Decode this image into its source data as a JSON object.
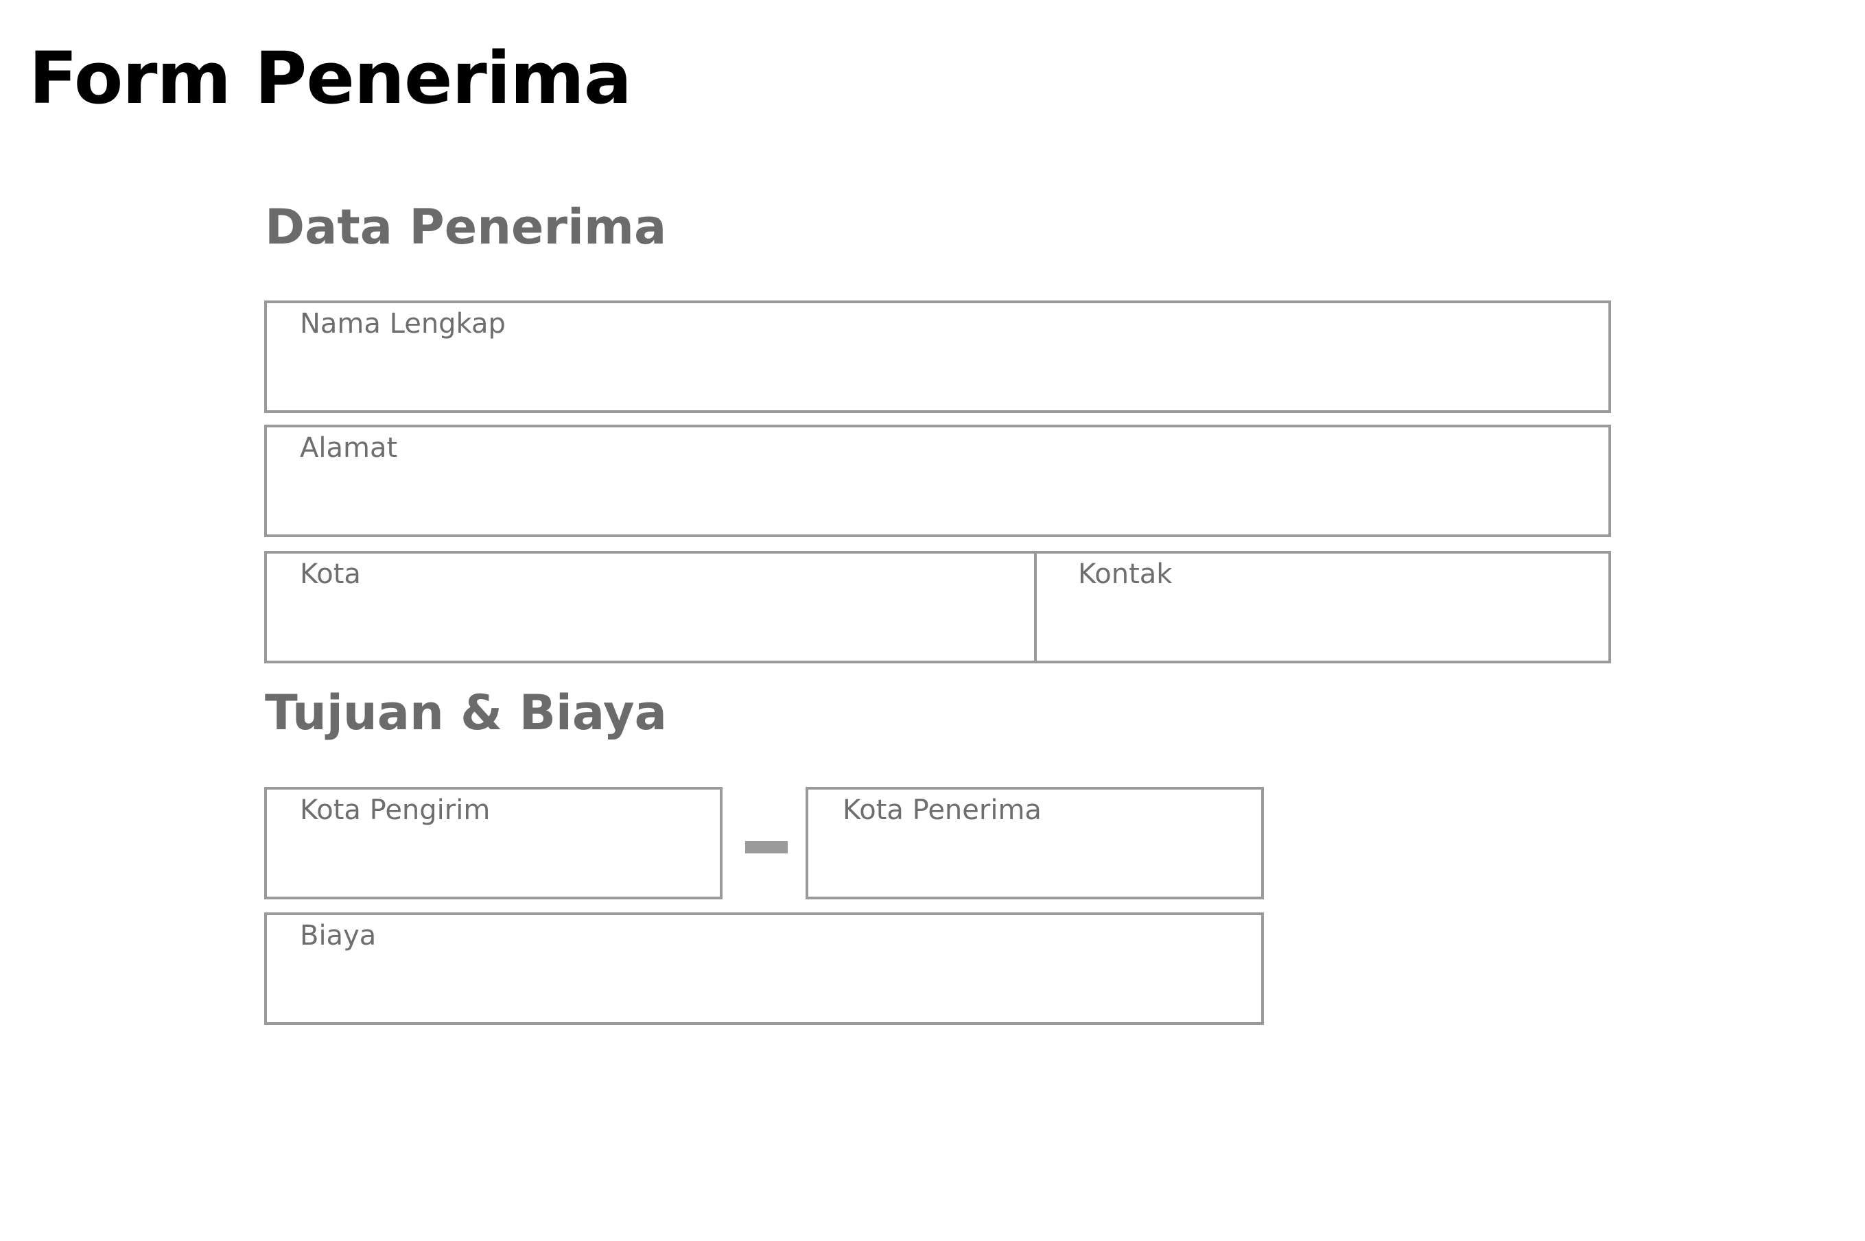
{
  "page": {
    "title": "Form Penerima"
  },
  "sections": {
    "data_penerima": {
      "title": "Data Penerima",
      "fields": {
        "nama_lengkap": {
          "label": "Nama Lengkap",
          "value": ""
        },
        "alamat": {
          "label": "Alamat",
          "value": ""
        },
        "kota": {
          "label": "Kota",
          "value": ""
        },
        "kontak": {
          "label": "Kontak",
          "value": ""
        }
      }
    },
    "tujuan_biaya": {
      "title": "Tujuan & Biaya",
      "fields": {
        "kota_pengirim": {
          "label": "Kota Pengirim",
          "value": ""
        },
        "kota_penerima": {
          "label": "Kota Penerima",
          "value": ""
        },
        "biaya": {
          "label": "Biaya",
          "value": ""
        }
      }
    }
  },
  "colors": {
    "title": "#000000",
    "section_title": "#6b6b6b",
    "field_border": "#9a9a9a",
    "field_label": "#6e6e6e"
  }
}
